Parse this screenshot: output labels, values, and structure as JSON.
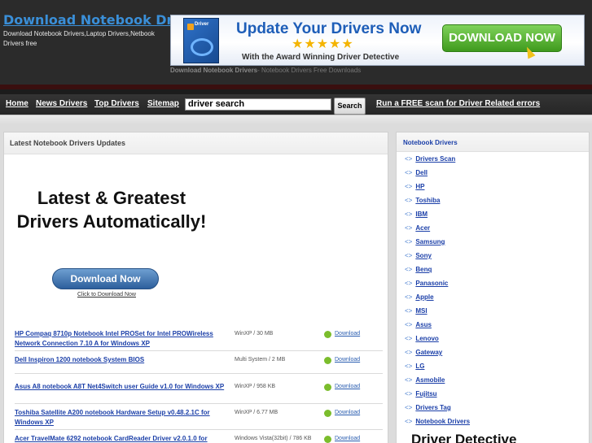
{
  "header": {
    "title": "Download Notebook Drivers",
    "tagline": "Download Notebook Drivers,Laptop Drivers,Netbook Drivers free",
    "caption_bold": "Download Notebook Drivers",
    "caption_rest": "- Notebook Drivers Free Downloads"
  },
  "banner": {
    "box_label": "Driver",
    "headline": "Update Your Drivers Now",
    "stars": "★★★★★",
    "subline": "With the Award Winning Driver Detective",
    "download_label": "DOWNLOAD NOW"
  },
  "nav": {
    "links": [
      "Home",
      "News Drivers",
      "Top Drivers",
      "Sitemap"
    ],
    "search_value": "driver search",
    "search_button": "Search",
    "scan_link": "Run a FREE scan for Driver Related errors"
  },
  "main": {
    "heading": "Latest Notebook Drivers Updates",
    "ad": {
      "headline": "Latest & Greatest Drivers Automatically!",
      "button": "Download Now",
      "caption": "Click to Download Now"
    },
    "rows": [
      {
        "title": "HP Compaq 8710p Notebook Intel PROSet for Intel PROWireless Network Connection 7.10 A for Windows XP",
        "meta": "WinXP / 30 MB",
        "download": "Download"
      },
      {
        "title": "Dell Inspiron 1200 notebook System BIOS",
        "meta": "Multi System / 2 MB",
        "download": "Download"
      },
      {
        "title": "Asus A8 notebook A8T Net4Switch user Guide v1.0 for Windows XP",
        "meta": "WinXP / 958 KB",
        "download": "Download"
      },
      {
        "title": "Toshiba Satellite A200 notebook Hardware Setup v0.48.2.1C for Windows XP",
        "meta": "WinXP / 6.77 MB",
        "download": "Download"
      },
      {
        "title": "Acer TravelMate 6292 notebook CardReader Driver v2.0.1.0 for",
        "meta": "Windows Vista(32bit) / 786 KB",
        "download": "Download"
      }
    ]
  },
  "sidebar": {
    "heading": "Notebook Drivers",
    "items": [
      "Drivers Scan",
      "Dell",
      "HP",
      "Toshiba",
      "IBM",
      "Acer",
      "Samsung",
      "Sony",
      "Benq",
      "Panasonic",
      "Apple",
      "MSI",
      "Asus",
      "Lenovo",
      "Gateway",
      "LG",
      "Asmobile",
      "Fujitsu",
      "Drivers Tag",
      "Notebook Drivers"
    ],
    "arrow": "<>",
    "logo_text": "Driver Detective"
  },
  "colors": {
    "link": "#1b3fa8",
    "header_bg": "#2b2b2b",
    "banner_button": "#3f9a1d"
  }
}
